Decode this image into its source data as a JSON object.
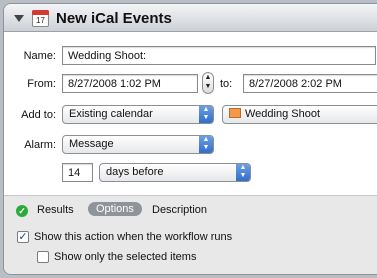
{
  "header": {
    "title": "New iCal Events",
    "calendar_icon_day": "17"
  },
  "form": {
    "name_label": "Name:",
    "name_value": "Wedding Shoot:",
    "from_label": "From:",
    "from_value": "8/27/2008   1:02 PM",
    "to_label": "to:",
    "to_value": "8/27/2008   2:02 PM",
    "add_to_label": "Add to:",
    "add_to_value": "Existing calendar",
    "calendar_value": "Wedding Shoot",
    "alarm_label": "Alarm:",
    "alarm_value": "Message",
    "alarm_days": "14",
    "alarm_unit": "days before"
  },
  "footer": {
    "tabs": [
      "Results",
      "Options",
      "Description"
    ],
    "selected_tab": "Options",
    "show_action_label": "Show this action when the workflow runs",
    "show_action_checked": true,
    "show_selected_label": "Show only the selected items",
    "show_selected_checked": false
  },
  "icons": {
    "disclosure": "triangle-down-icon",
    "calendar": "ical-icon",
    "results_status": "green-check-icon"
  },
  "colors": {
    "accent": "#2d6bc9",
    "calendar_swatch": "#f39a4a",
    "selected_tab": "#8f949b"
  }
}
